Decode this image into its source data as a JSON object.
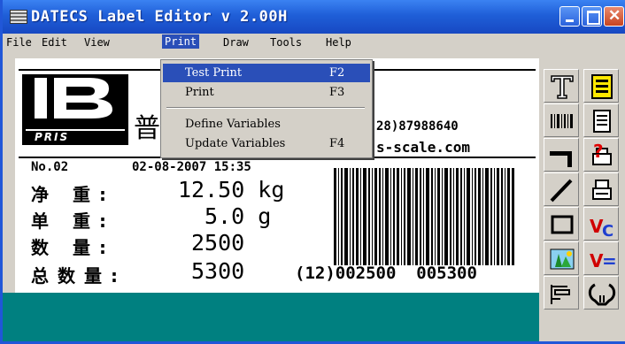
{
  "window": {
    "title": "DATECS Label Editor v 2.00H"
  },
  "menubar": {
    "items": [
      "File",
      "Edit",
      "View",
      "Print",
      "Draw",
      "Tools",
      "Help"
    ],
    "active": "Print"
  },
  "print_menu": {
    "items": [
      {
        "label": "Test Print",
        "shortcut": "F2",
        "highlighted": true
      },
      {
        "label": "Print",
        "shortcut": "F3",
        "highlighted": false
      },
      {
        "label": "Define Variables",
        "shortcut": "",
        "highlighted": false
      },
      {
        "label": "Update Variables",
        "shortcut": "F4",
        "highlighted": false
      }
    ]
  },
  "label": {
    "logo_text": "PRIS",
    "logo_char": "普",
    "phone": "28)87988640",
    "website": "s-scale.com",
    "number": "No.02",
    "datetime": "02-08-2007 15:35",
    "fields": [
      {
        "label": "净 重:",
        "value": "12.50 kg"
      },
      {
        "label": "单 重:",
        "value": "5.0 g"
      },
      {
        "label": "数 量:",
        "value": "2500"
      },
      {
        "label": "总数量:",
        "value": "5300"
      }
    ],
    "barcode_text": "(12)002500  005300"
  },
  "toolbox": {
    "tools": [
      "text-tool-icon",
      "text-box-tool-icon",
      "barcode-tool-icon",
      "list-tool-icon",
      "crosshair-tool-icon",
      "help-tool-icon",
      "line-tool-icon",
      "print-tool-icon",
      "rectangle-tool-icon",
      "variable-counter-icon",
      "image-tool-icon",
      "variable-equals-icon",
      "layout-tool-icon",
      "settings-tool-icon"
    ]
  },
  "colors": {
    "titlebar": "#1f5fd8",
    "menu_highlight": "#2a4fb8",
    "workspace": "#008080",
    "chrome": "#d4d0c8"
  }
}
